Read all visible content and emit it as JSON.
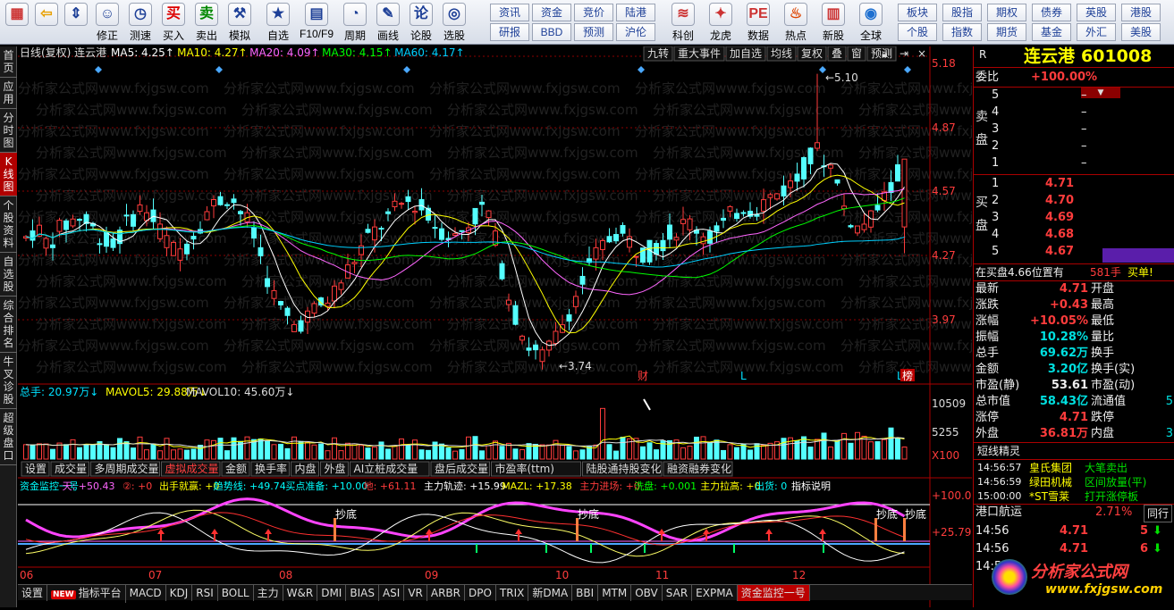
{
  "toolbar": {
    "buttons": [
      {
        "id": "grid",
        "label": "",
        "icon": "grid-icon"
      },
      {
        "id": "back",
        "label": "",
        "icon": "back-arrow-icon"
      },
      {
        "id": "updown",
        "label": "",
        "icon": "updown-icon"
      },
      {
        "id": "fix",
        "label": "修正",
        "icon": "fix-icon"
      },
      {
        "id": "test",
        "label": "测速",
        "icon": "clock-icon"
      },
      {
        "id": "buy",
        "label": "买入",
        "icon": "buy-icon"
      },
      {
        "id": "sell",
        "label": "卖出",
        "icon": "sell-icon"
      },
      {
        "id": "sim",
        "label": "模拟",
        "icon": "hammer-icon"
      },
      {
        "id": "selfsel",
        "label": "自选",
        "icon": "star-icon"
      },
      {
        "id": "f10",
        "label": "F10/F9",
        "icon": "f10-icon"
      },
      {
        "id": "period",
        "label": "周期",
        "icon": "period-icon"
      },
      {
        "id": "draw",
        "label": "画线",
        "icon": "pencil-icon"
      },
      {
        "id": "forum",
        "label": "论股",
        "icon": "forum-icon"
      },
      {
        "id": "pick",
        "label": "选股",
        "icon": "pick-icon"
      }
    ],
    "small_buttons": [
      [
        "资讯",
        "研报"
      ],
      [
        "资金",
        "BBD"
      ],
      [
        "竞价",
        "预测"
      ],
      [
        "陆港",
        "沪伦"
      ]
    ],
    "mid_buttons": [
      {
        "label": "科创",
        "icon": "chart-icon"
      },
      {
        "label": "龙虎",
        "icon": "dragon-icon"
      },
      {
        "label": "数据",
        "icon": "pe-icon"
      },
      {
        "label": "热点",
        "icon": "fire-icon"
      },
      {
        "label": "新股",
        "icon": "newstock-icon"
      },
      {
        "label": "全球",
        "icon": "globe-icon"
      }
    ],
    "right_buttons": [
      [
        "板块",
        "个股"
      ],
      [
        "股指",
        "指数"
      ],
      [
        "期权",
        "期货"
      ],
      [
        "债券",
        "基金"
      ],
      [
        "英股",
        "外汇"
      ],
      [
        "港股",
        "美股"
      ]
    ]
  },
  "leftbar": [
    "首页",
    "应用",
    "分时图",
    "K线图",
    "个股资料",
    "自选股",
    "综合排名",
    "牛叉诊股",
    "超级盘口"
  ],
  "leftbar_active": 3,
  "kline_header": {
    "title": "日线(复权)",
    "name": "连云港",
    "ma": [
      {
        "label": "MA5: 4.25",
        "color": "#ffffff"
      },
      {
        "label": "MA10: 4.27",
        "color": "#ffff00"
      },
      {
        "label": "MA20: 4.09",
        "color": "#ff66ff"
      },
      {
        "label": "MA30: 4.15",
        "color": "#00ff00"
      },
      {
        "label": "MA60: 4.17",
        "color": "#00d0ff"
      }
    ],
    "tools": [
      "九转",
      "重大事件",
      "加自选",
      "均线",
      "复权",
      "叠",
      "窗",
      "预测"
    ]
  },
  "price_axis": [
    "5.18",
    "4.87",
    "4.57",
    "4.27",
    "3.97"
  ],
  "high_label": "5.10",
  "low_label": "3.74",
  "event_marks": [
    "财",
    "L",
    "L",
    "榜"
  ],
  "vol_header": {
    "label": "总手: 20.97万",
    "mavol5": "MAVOL5: 29.88万",
    "mavol10": "MAVOL10: 45.60万"
  },
  "vol_axis": [
    "10509",
    "5255",
    "X100"
  ],
  "ind_tabs": [
    "设置",
    "成交量",
    "多周期成交量",
    "虚拟成交量",
    "金额",
    "换手率",
    "内盘",
    "外盘",
    "AI立桩成交量",
    "盘后成交量",
    "市盈率(ttm)",
    "陆股通持股变化",
    "融资融券变化"
  ],
  "ind_tab_active": 3,
  "ind_header": [
    {
      "t": "资金监控一号",
      "c": "#00ffff"
    },
    {
      "t": "天: +50.43",
      "c": "#ff66ff"
    },
    {
      "t": "②: +0",
      "c": "#ff3c3c"
    },
    {
      "t": "出手就赢: +0",
      "c": "#ffff00"
    },
    {
      "t": "趋势线: +49.74",
      "c": "#00ffff"
    },
    {
      "t": "买点准备: +10.00",
      "c": "#00ffff"
    },
    {
      "t": "地: +61.11",
      "c": "#ff3c3c"
    },
    {
      "t": "主力轨迹: +15.99",
      "c": "#ffffff"
    },
    {
      "t": "MAZL: +17.38",
      "c": "#ffff00"
    },
    {
      "t": "主力进场: +0",
      "c": "#ff3c3c"
    },
    {
      "t": "洗盘: +0.001",
      "c": "#00ff00"
    },
    {
      "t": "主力拉高: +0",
      "c": "#ffff00"
    },
    {
      "t": "出货: 0",
      "c": "#00ffff"
    },
    {
      "t": "指标说明",
      "c": "#ffffff"
    }
  ],
  "ind_axis": [
    "100.0",
    "25.79"
  ],
  "ind_marks": [
    "抄底",
    "抄底",
    "抄底",
    "抄底"
  ],
  "months": [
    "06",
    "07",
    "08",
    "09",
    "10",
    "11",
    "12"
  ],
  "bottom_tabs": [
    "设置",
    "指标平台",
    "MACD",
    "KDJ",
    "RSI",
    "BOLL",
    "主力",
    "W&R",
    "DMI",
    "BIAS",
    "ASI",
    "VR",
    "ARBR",
    "DPO",
    "TRIX",
    "新DMA",
    "BBI",
    "MTM",
    "OBV",
    "SAR",
    "EXPMA",
    "资金监控一号"
  ],
  "bottom_new_badge": "NEW",
  "bottom_active": 21,
  "quote": {
    "code_prefix": "R",
    "name": "连云港",
    "code": "601008",
    "weibi_label": "委比",
    "weibi": "+100.00%",
    "sell_label": "卖盘",
    "buy_label": "买盘",
    "sell": [
      {
        "n": "5",
        "p": "",
        "v": "–"
      },
      {
        "n": "4",
        "p": "",
        "v": "–"
      },
      {
        "n": "3",
        "p": "",
        "v": "–"
      },
      {
        "n": "2",
        "p": "",
        "v": "–"
      },
      {
        "n": "1",
        "p": "",
        "v": "–"
      }
    ],
    "buy": [
      {
        "n": "1",
        "p": "4.71",
        "v": ""
      },
      {
        "n": "2",
        "p": "4.70",
        "v": ""
      },
      {
        "n": "3",
        "p": "4.69",
        "v": ""
      },
      {
        "n": "4",
        "p": "4.68",
        "v": ""
      },
      {
        "n": "5",
        "p": "4.67",
        "v": ""
      }
    ],
    "position_text": "在买盘4.66位置有",
    "position_vol": "581手",
    "position_action": "买单!",
    "stats": [
      {
        "l": "最新",
        "v": "4.71",
        "c": "red",
        "l2": "开盘",
        "v2": ""
      },
      {
        "l": "涨跌",
        "v": "+0.43",
        "c": "red",
        "l2": "最高",
        "v2": ""
      },
      {
        "l": "涨幅",
        "v": "+10.05%",
        "c": "red",
        "l2": "最低",
        "v2": ""
      },
      {
        "l": "振幅",
        "v": "10.28%",
        "c": "cyan",
        "l2": "量比",
        "v2": ""
      },
      {
        "l": "总手",
        "v": "69.62万",
        "c": "cyan",
        "l2": "换手",
        "v2": ""
      },
      {
        "l": "金额",
        "v": "3.20亿",
        "c": "cyan",
        "l2": "换手(实)",
        "v2": ""
      },
      {
        "l": "市盈(静)",
        "v": "53.61",
        "c": "wht",
        "l2": "市盈(动)",
        "v2": ""
      },
      {
        "l": "总市值",
        "v": "58.43亿",
        "c": "cyan",
        "l2": "流通值",
        "v2": "5"
      },
      {
        "l": "涨停",
        "v": "4.71",
        "c": "red",
        "l2": "跌停",
        "v2": ""
      },
      {
        "l": "外盘",
        "v": "36.81万",
        "c": "red",
        "l2": "内盘",
        "v2": "3"
      }
    ],
    "elf_title": "短线精灵",
    "elf": [
      {
        "t": "14:56:57",
        "n": "皇氏集团",
        "a": "大笔卖出",
        "ac": "grn"
      },
      {
        "t": "14:56:59",
        "n": "绿田机械",
        "a": "区间放量(平)",
        "ac": "grn"
      },
      {
        "t": "15:00:00",
        "n": "*ST雪莱",
        "a": "打开涨停板",
        "ac": "grn"
      }
    ],
    "hangye": "港口航运",
    "hangye_pct": "2.71%",
    "hangye_btn": "同行",
    "ticks": [
      {
        "t": "14:56",
        "p": "4.71",
        "v": "5"
      },
      {
        "t": "14:56",
        "p": "4.71",
        "v": "6"
      },
      {
        "t": "14:56",
        "p": "",
        "v": ""
      }
    ]
  },
  "watermark": "分析家公式网www.fxjgsw.com",
  "logo": {
    "title": "分析家公式网",
    "url": "www.fxjgsw.com"
  }
}
